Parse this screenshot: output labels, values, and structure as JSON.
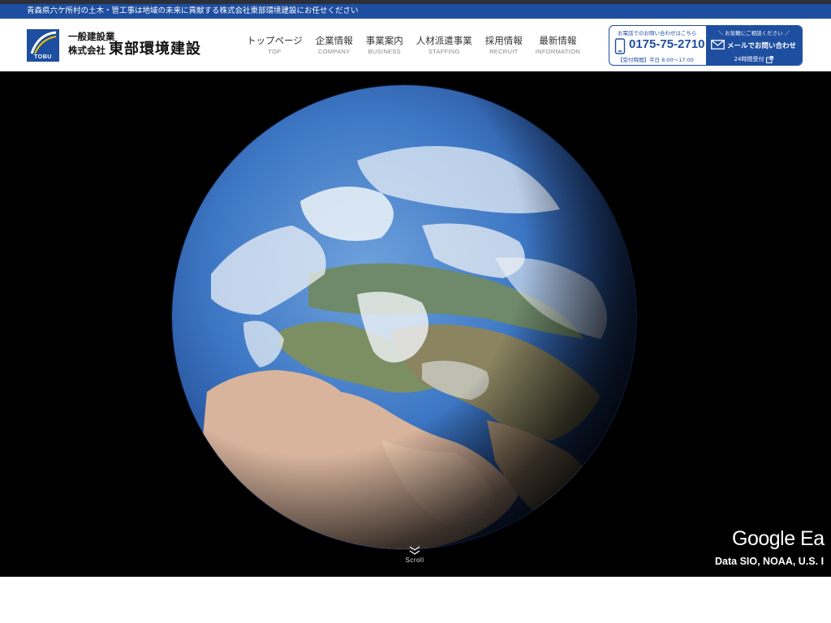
{
  "tagline": "青森県六ケ所村の土木・管工事は地域の未来に貢献する株式会社東部環境建設にお任せください",
  "logo": {
    "mark_text": "TOBU",
    "line1": "一般建設業",
    "line2_prefix": "株式会社",
    "line2_name": "東部環境建設"
  },
  "nav": [
    {
      "ja": "トップページ",
      "en": "TOP"
    },
    {
      "ja": "企業情報",
      "en": "COMPANY"
    },
    {
      "ja": "事業案内",
      "en": "BUSINESS"
    },
    {
      "ja": "人材派遣事業",
      "en": "STAFFING"
    },
    {
      "ja": "採用情報",
      "en": "RECRUIT"
    },
    {
      "ja": "最新情報",
      "en": "INFORMATION"
    }
  ],
  "contact": {
    "tel_caption": "お電話でのお問い合わせはこちら",
    "phone": "0175-75-2710",
    "hours": "【受付時間】平日 8:00～17:00",
    "mail_caption": "＼ お気軽にご相談ください ／",
    "mail_label": "メールでお問い合わせ",
    "mail_sub": "24時間受付"
  },
  "hero": {
    "scroll_label": "Scroll",
    "attribution_logo": "Google Ea",
    "attribution_data": "Data SIO, NOAA, U.S. I"
  },
  "colors": {
    "brand_blue": "#1e4ea0",
    "hero_bg": "#000000"
  }
}
